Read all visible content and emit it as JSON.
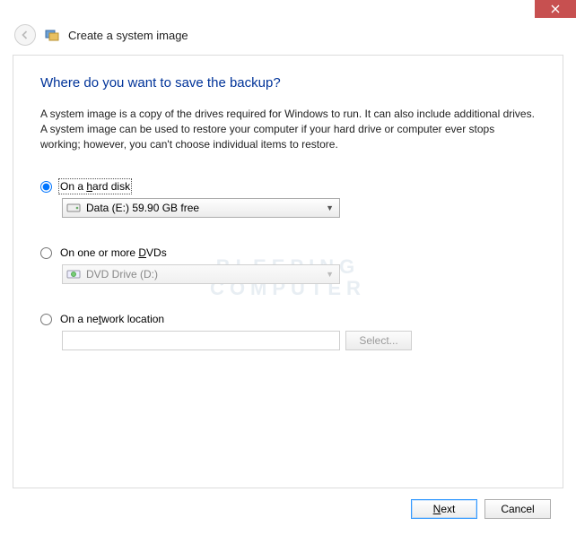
{
  "window": {
    "title": "Create a system image"
  },
  "wizard": {
    "heading": "Where do you want to save the backup?",
    "description": "A system image is a copy of the drives required for Windows to run. It can also include additional drives. A system image can be used to restore your computer if your hard drive or computer ever stops working; however, you can't choose individual items to restore."
  },
  "options": {
    "hard_disk": {
      "label_pre": "On a ",
      "label_u": "h",
      "label_post": "ard disk",
      "selected_drive": "Data (E:)  59.90 GB free",
      "checked": true
    },
    "dvds": {
      "label_pre": "On one or more ",
      "label_u": "D",
      "label_post": "VDs",
      "selected_drive": "DVD Drive (D:)",
      "checked": false
    },
    "network": {
      "label_pre": "On a ne",
      "label_u": "t",
      "label_post": "work location",
      "value": "",
      "select_label": "Select...",
      "checked": false
    }
  },
  "footer": {
    "next": "Next",
    "cancel": "Cancel"
  },
  "watermark": {
    "line1": "BLEEPING",
    "line2": "COMPUTER"
  }
}
